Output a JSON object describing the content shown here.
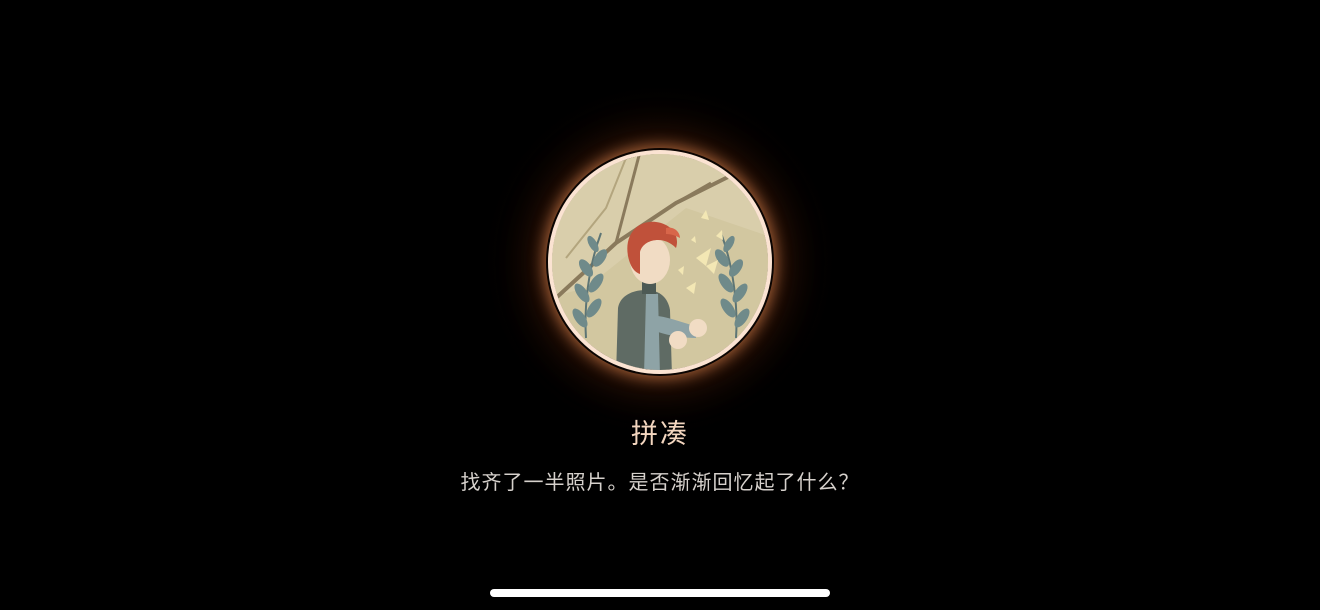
{
  "achievement": {
    "title": "拼凑",
    "description": "找齐了一半照片。是否渐渐回忆起了什么？",
    "badge_icon": "boy-with-butterfly-laurel-icon",
    "glow_color": "#f5965a",
    "ring_color": "#fbe3d2"
  },
  "system": {
    "home_indicator": "home-indicator-bar"
  }
}
